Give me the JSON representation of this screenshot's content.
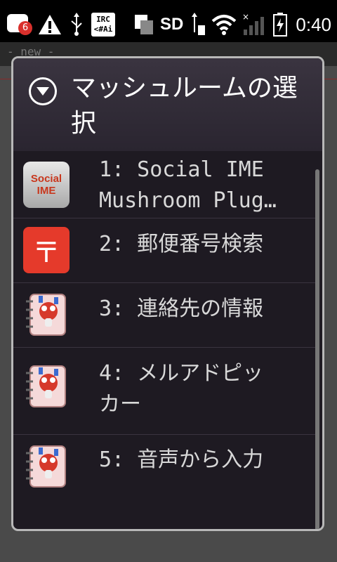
{
  "status_bar": {
    "notification_count": "6",
    "irc_icon_text": "IRC\n<#Ai",
    "sd_label": "SD",
    "time": "0:40"
  },
  "background": {
    "new_label": "- new -"
  },
  "dialog": {
    "title": "マッシュルームの選択",
    "items": [
      {
        "label": "1: Social IME\nMushroom Plug…",
        "icon": "social-ime-icon",
        "icon_text": "Social\nIME"
      },
      {
        "label": "2: 郵便番号検索",
        "icon": "postal-mark-icon",
        "icon_text": "〒"
      },
      {
        "label": "3: 連絡先の情報",
        "icon": "contact-notebook-icon"
      },
      {
        "label": "4: メルアドピッ\nカー",
        "icon": "contact-notebook-icon"
      },
      {
        "label": "5: 音声から入力",
        "icon": "contact-notebook-icon"
      }
    ]
  },
  "colors": {
    "dialog_bg": "#1e1a22",
    "header_bg": "#3a3440",
    "item_text": "#d8d8d8",
    "postal_red": "#e53a2b"
  }
}
